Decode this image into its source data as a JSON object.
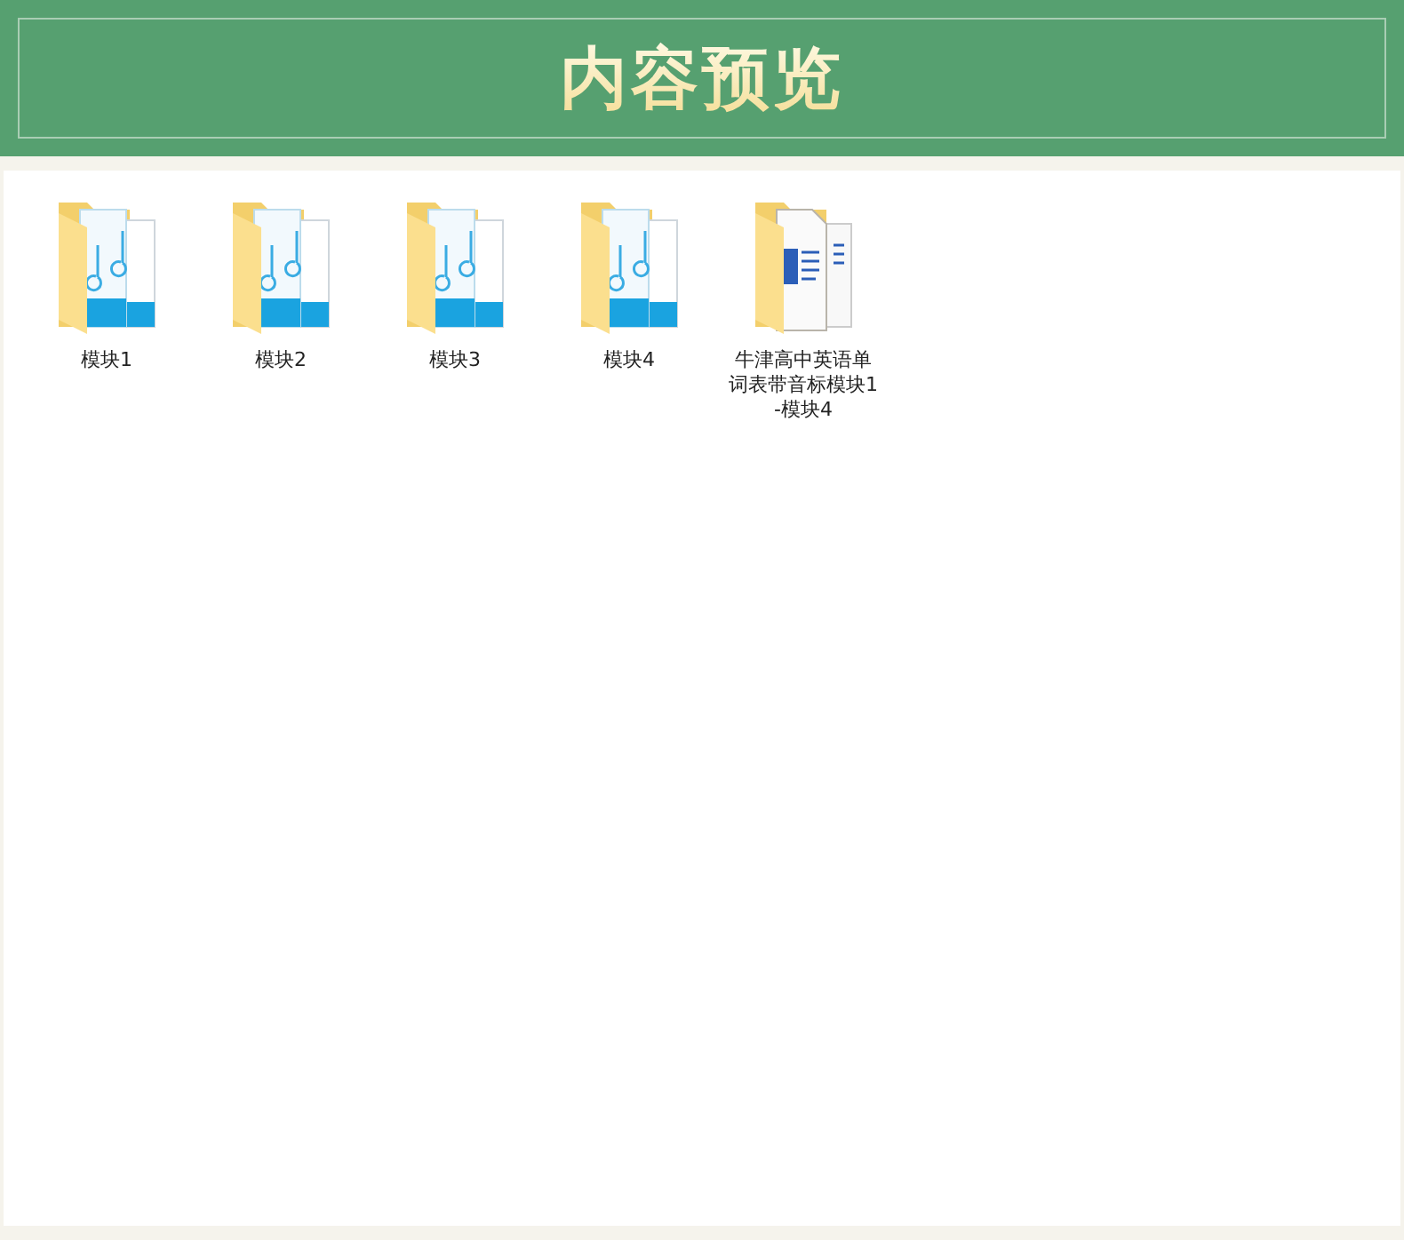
{
  "header": {
    "title": "内容预览"
  },
  "items": [
    {
      "name": "模块1",
      "kind": "audio"
    },
    {
      "name": "模块2",
      "kind": "audio"
    },
    {
      "name": "模块3",
      "kind": "audio"
    },
    {
      "name": "模块4",
      "kind": "audio"
    },
    {
      "name": "牛津高中英语单词表带音标模块1-模块4",
      "kind": "document"
    }
  ]
}
